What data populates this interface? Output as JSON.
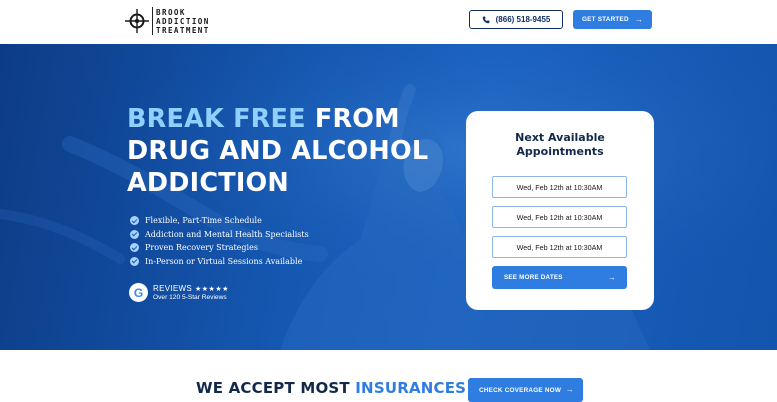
{
  "brand": {
    "name_lines": [
      "BROOK",
      "ADDICTION",
      "TREATMENT"
    ]
  },
  "header": {
    "phone_label": "(866) 518-9455",
    "cta_label": "GET STARTED"
  },
  "hero": {
    "headline_accent": "BREAK FREE",
    "headline_rest_1": " FROM",
    "headline_line_2": "DRUG AND ALCOHOL",
    "headline_line_3": "ADDICTION",
    "features": [
      "Flexible, Part-Time Schedule",
      "Addiction and Mental Health Specialists",
      "Proven Recovery Strategies",
      "In-Person or Virtual Sessions Available"
    ],
    "reviews": {
      "label": "REVIEWS",
      "stars": "★★★★★",
      "sub": "Over 120 5-Star Reviews",
      "google_letter": "G"
    }
  },
  "appointments": {
    "title_line_1": "Next Available",
    "title_line_2": "Appointments",
    "slots": [
      "Wed, Feb 12th at 10:30AM",
      "Wed, Feb 12th at 10:30AM",
      "Wed, Feb 12th at 10:30AM"
    ],
    "see_more_label": "SEE MORE DATES"
  },
  "insurance": {
    "title_main": "WE ACCEPT MOST ",
    "title_accent": "INSURANCES",
    "button_label": "CHECK COVERAGE NOW"
  },
  "icons": {
    "arrow": "→",
    "logo": "compass-crosshair-icon",
    "phone": "phone-icon",
    "check": "check-circle-icon"
  },
  "colors": {
    "brand_navy": "#13294b",
    "accent_blue": "#2f7de1",
    "hero_blue": "#1558b2",
    "headline_accent": "#8fd0ff"
  }
}
